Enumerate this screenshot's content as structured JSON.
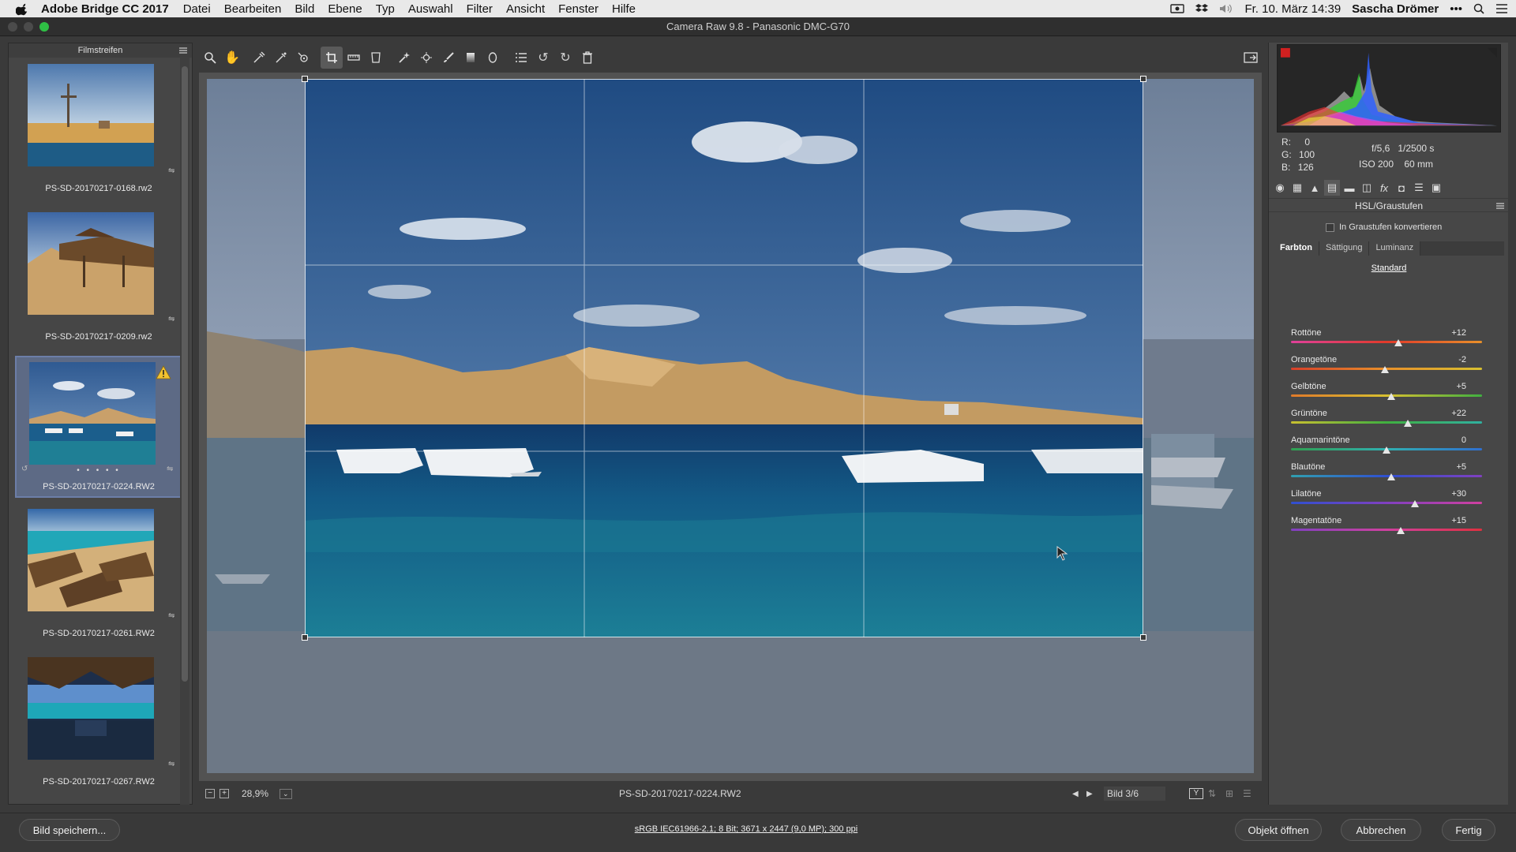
{
  "menubar": {
    "app": "Adobe Bridge CC 2017",
    "items": [
      "Datei",
      "Bearbeiten",
      "Bild",
      "Ebene",
      "Typ",
      "Auswahl",
      "Filter",
      "Ansicht",
      "Fenster",
      "Hilfe"
    ],
    "clock": "Fr. 10. März  14:39",
    "user": "Sascha Drömer",
    "more": "•••"
  },
  "window": {
    "title": "Camera Raw 9.8  -  Panasonic DMC-G70"
  },
  "filmstrip": {
    "title": "Filmstreifen",
    "items": [
      {
        "label": "PS-SD-20170217-0168.rw2"
      },
      {
        "label": "PS-SD-20170217-0209.rw2"
      },
      {
        "label": "PS-SD-20170217-0224.RW2",
        "selected": true,
        "rating_dots": "• • • • •"
      },
      {
        "label": "PS-SD-20170217-0261.RW2"
      },
      {
        "label": "PS-SD-20170217-0267.RW2"
      }
    ]
  },
  "toolbar": {
    "tools": [
      "zoom-icon",
      "hand-icon",
      "white-balance-icon",
      "color-sampler-icon",
      "target-adjust-icon",
      "crop-icon",
      "straighten-icon",
      "transform-icon",
      "spot-removal-icon",
      "red-eye-icon",
      "adjustment-brush-icon",
      "graduated-filter-icon",
      "radial-filter-icon",
      "preferences-icon",
      "rotate-left-icon",
      "rotate-right-icon",
      "trash-icon"
    ]
  },
  "view": {
    "zoom": "28,9%",
    "filename": "PS-SD-20170217-0224.RW2",
    "image_counter": "Bild 3/6"
  },
  "info": {
    "r_label": "R:",
    "r": "0",
    "g_label": "G:",
    "g": "100",
    "b_label": "B:",
    "b": "126",
    "aperture": "f/5,6",
    "shutter": "1/2500 s",
    "iso": "ISO 200",
    "focal": "60 mm"
  },
  "panel": {
    "title": "HSL/Graustufen",
    "grayscale_label": "In Graustufen konvertieren",
    "tabs": [
      "Farbton",
      "Sättigung",
      "Luminanz"
    ],
    "active_tab": "Farbton",
    "standard": "Standard",
    "sliders": [
      {
        "name": "Rottöne",
        "value": "+12",
        "num": 12,
        "colors": [
          "#e0409a",
          "#e23a2a",
          "#e8902a"
        ]
      },
      {
        "name": "Orangetöne",
        "value": "-2",
        "num": -2,
        "colors": [
          "#d8402a",
          "#e8902a",
          "#d8c030"
        ]
      },
      {
        "name": "Gelbtöne",
        "value": "+5",
        "num": 5,
        "colors": [
          "#e07a2a",
          "#d8c030",
          "#40b040"
        ]
      },
      {
        "name": "Grüntöne",
        "value": "+22",
        "num": 22,
        "colors": [
          "#c8c030",
          "#40b040",
          "#30b0a0"
        ]
      },
      {
        "name": "Aquamarintöne",
        "value": "0",
        "num": 0,
        "colors": [
          "#30a050",
          "#30b0b0",
          "#3070d0"
        ]
      },
      {
        "name": "Blautöne",
        "value": "+5",
        "num": 5,
        "colors": [
          "#30a0b0",
          "#3050d0",
          "#8040c0"
        ]
      },
      {
        "name": "Lilatöne",
        "value": "+30",
        "num": 30,
        "colors": [
          "#3050d0",
          "#8040c0",
          "#d040a0"
        ]
      },
      {
        "name": "Magentatöne",
        "value": "+15",
        "num": 15,
        "colors": [
          "#8040c0",
          "#d040a0",
          "#e03040"
        ]
      }
    ]
  },
  "bottom": {
    "save": "Bild speichern...",
    "workflow": "sRGB IEC61966-2.1; 8 Bit; 3671 x 2447 (9,0 MP); 300 ppi",
    "open": "Objekt öffnen",
    "cancel": "Abbrechen",
    "done": "Fertig"
  },
  "colors": {
    "accent_selected": "#5d6a85",
    "panel_bg": "#474747"
  }
}
